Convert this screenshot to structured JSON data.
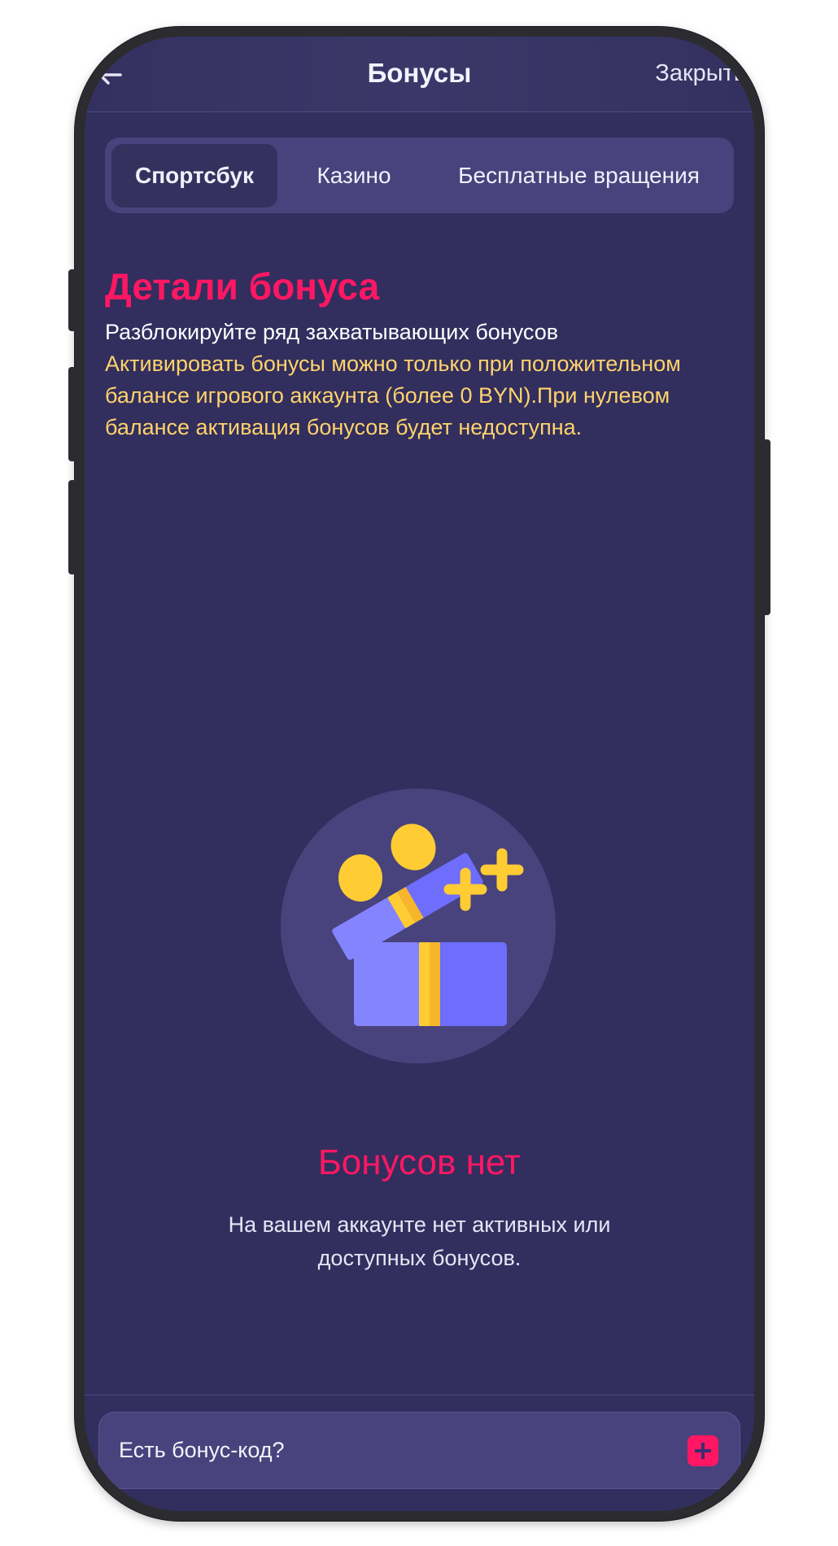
{
  "header": {
    "back_icon": "arrow-left-icon",
    "title": "Бонусы",
    "close_label": "Закрыть"
  },
  "tabs": [
    {
      "label": "Спортсбук",
      "active": true
    },
    {
      "label": "Казино",
      "active": false
    },
    {
      "label": "Бесплатные вращения",
      "active": false
    }
  ],
  "details": {
    "title": "Детали бонуса",
    "subtitle": "Разблокируйте ряд захватывающих бонусов",
    "warning": "Активировать бонусы можно только при положительном балансе игрового аккаунта (более 0 BYN).При нулевом балансе активация бонусов будет недоступна."
  },
  "empty_state": {
    "illustration": "gift-box-icon",
    "title": "Бонусов нет",
    "text": "На вашем аккаунте нет активных или доступных бонусов."
  },
  "promo": {
    "label": "Есть бонус-код?",
    "button_icon": "plus-icon"
  },
  "colors": {
    "background": "#322e5e",
    "panel": "#48437c",
    "accent": "#ff1763",
    "warning": "#ffd36b"
  }
}
